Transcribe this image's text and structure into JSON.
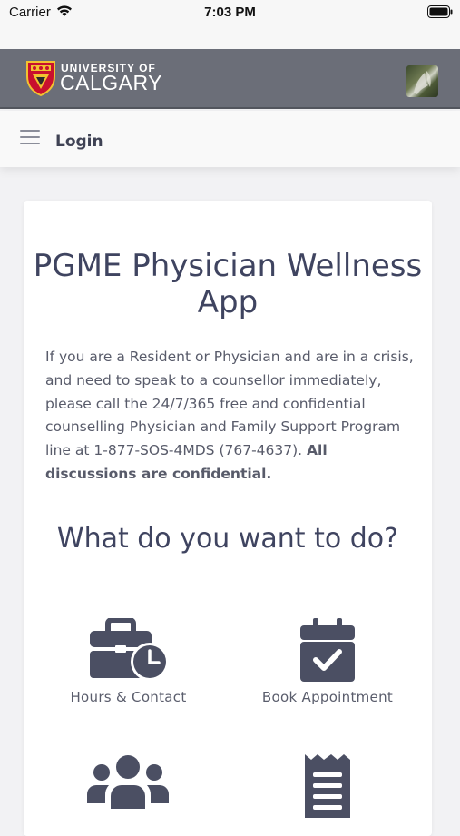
{
  "status_bar": {
    "carrier": "Carrier",
    "time": "7:03 PM"
  },
  "header": {
    "university_line1": "UNIVERSITY OF",
    "university_line2": "CALGARY"
  },
  "nav": {
    "title": "Login"
  },
  "main": {
    "app_title": "PGME Physician Wellness App",
    "crisis_text": "If you are a Resident or Physician and are in a crisis, and need to speak to a counsellor immediately, please call the 24/7/365 free and confidential counselling Physician and Family Support Program line at 1-877-SOS-4MDS (767-4637).",
    "crisis_emphasis": "All discussions are confidential.",
    "section_title": "What do you want to do?",
    "actions": [
      {
        "label": "Hours & Contact",
        "icon": "briefcase-clock-icon"
      },
      {
        "label": "Book Appointment",
        "icon": "calendar-check-icon"
      },
      {
        "label": "",
        "icon": "users-icon"
      },
      {
        "label": "",
        "icon": "receipt-icon"
      }
    ]
  },
  "colors": {
    "header_bg": "#6b6e78",
    "text_dark": "#3f4460",
    "icon": "#4b4f63"
  }
}
